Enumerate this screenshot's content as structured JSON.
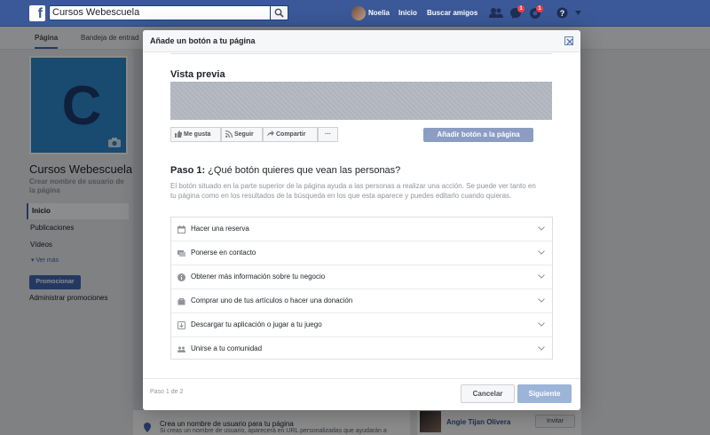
{
  "topbar": {
    "logo": "f",
    "search_value": "Cursos Webescuela",
    "user_name": "Noelia",
    "home_link": "Inicio",
    "find_friends_link": "Buscar amigos",
    "messages_badge": "1",
    "notifications_badge": "1"
  },
  "subnav": {
    "tab_page": "Página",
    "tab_inbox": "Bandeja de entrad"
  },
  "page": {
    "cover_letter": "C",
    "name": "Cursos Webescuela",
    "username_prompt": "Crear nombre de usuario de la página",
    "nav": [
      "Inicio",
      "Publicaciones",
      "Vídeos"
    ],
    "see_more": "Ver más",
    "promote_button": "Promocionar",
    "admin_promotions": "Administrar promociones",
    "bottom_card_title": "Crea un nombre de usuario para tu página",
    "bottom_card_sub": "Si creas un nombre de usuario, aparecerá en URL personalizadas que ayudarán a",
    "friend_name": "Angie Tijan Olivera",
    "invite_button": "Invitar"
  },
  "modal": {
    "title": "Añade un botón a tu página",
    "preview_label": "Vista previa",
    "preview_actions": [
      "Me gusta",
      "Seguir",
      "Compartir",
      "···"
    ],
    "add_button": "Añadir botón a la página",
    "step_prefix": "Paso 1:",
    "step_question": "¿Qué botón quieres que vean las personas?",
    "step_description": "El botón situado en la parte superior de la página ayuda a las personas a realizar una acción. Se puede ver tanto en tu página como en los resultados de la búsqueda en los que esta aparece y puedes editarlo cuando quieras.",
    "options": [
      {
        "label": "Hacer una reserva",
        "icon": "calendar-icon"
      },
      {
        "label": "Ponerse en contacto",
        "icon": "chat-icon"
      },
      {
        "label": "Obtener más información sobre tu negocio",
        "icon": "info-icon"
      },
      {
        "label": "Comprar uno de tus artículos o hacer una donación",
        "icon": "shopping-bag-icon"
      },
      {
        "label": "Descargar tu aplicación o jugar a tu juego",
        "icon": "download-icon"
      },
      {
        "label": "Unirse a tu comunidad",
        "icon": "people-icon"
      }
    ],
    "step_counter": "Paso 1 de 2",
    "cancel_button": "Cancelar",
    "next_button": "Siguiente"
  },
  "colors": {
    "brand": "#3b5998",
    "primary_button_disabled": "#8b9dc3",
    "next_button_disabled": "#9cb4d8"
  }
}
